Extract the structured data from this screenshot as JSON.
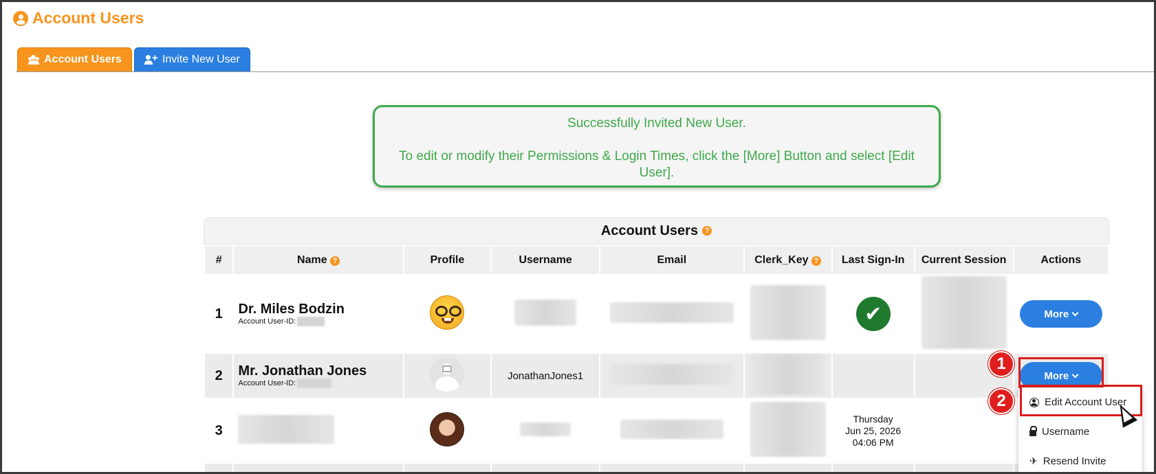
{
  "header": {
    "title": "Account Users"
  },
  "tabs": [
    {
      "label": "Account Users",
      "active": true
    },
    {
      "label": "Invite New User",
      "active": false
    }
  ],
  "alert": {
    "line1": "Successfully Invited New User.",
    "line2": "To edit or modify their Permissions & Login Times, click the [More] Button and select [Edit User]."
  },
  "table": {
    "caption": "Account Users",
    "columns": [
      "#",
      "Name",
      "Profile",
      "Username",
      "Email",
      "Clerk_Key",
      "Last Sign-In",
      "Current Session",
      "Actions"
    ],
    "rows": [
      {
        "num": "1",
        "name": "Dr. Miles Bodzin",
        "sub_label": "Account User-ID:",
        "username": "",
        "last_signin": "",
        "action": "More"
      },
      {
        "num": "2",
        "name": "Mr. Jonathan Jones",
        "sub_label": "Account User-ID:",
        "username": "JonathanJones1",
        "last_signin": "",
        "action": "More"
      },
      {
        "num": "3",
        "name": "",
        "sub_label": "",
        "username": "",
        "last_signin_day": "Thursday",
        "last_signin_date": "Jun 25, 2026",
        "last_signin_time": "04:06 PM",
        "action": ""
      }
    ]
  },
  "dropdown": {
    "items": [
      "Edit Account User",
      "Username",
      "Resend Invite"
    ]
  },
  "annotations": {
    "step1": "1",
    "step2": "2"
  },
  "colors": {
    "accent_orange": "#f7941d",
    "accent_blue": "#2b7fe0",
    "success_green": "#3ea84a",
    "annotation_red": "#e01e1e"
  }
}
